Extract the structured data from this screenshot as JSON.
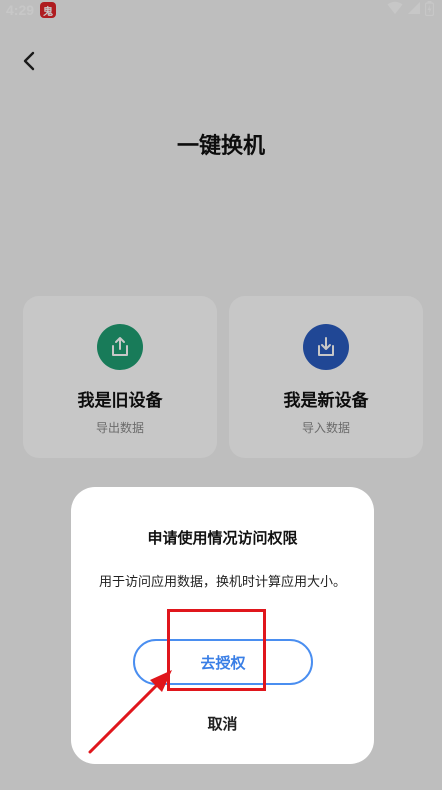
{
  "status_bar": {
    "time": "4:29",
    "app_badge": "鬼"
  },
  "page": {
    "title": "一键换机",
    "cards": [
      {
        "title": "我是旧设备",
        "subtitle": "导出数据",
        "icon": "upload-icon",
        "icon_color": "#1f9e73"
      },
      {
        "title": "我是新设备",
        "subtitle": "导入数据",
        "icon": "download-icon",
        "icon_color": "#2a5cbf"
      }
    ]
  },
  "dialog": {
    "title": "申请使用情况访问权限",
    "body": "用于访问应用数据，换机时计算应用大小。",
    "grant_label": "去授权",
    "cancel_label": "取消"
  },
  "colors": {
    "accent": "#3a7fe6",
    "annotation": "#e0161c"
  }
}
